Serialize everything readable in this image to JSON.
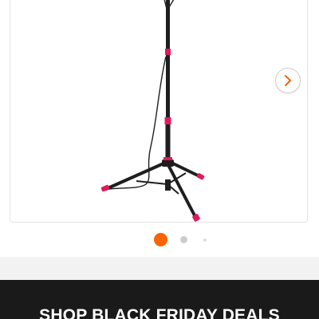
{
  "carousel": {
    "image_alt": "Portable light stand tripod with red accents",
    "next_icon": "chevron-right-icon",
    "slide_count": 3,
    "active_slide": 1
  },
  "promo": {
    "text": "SHOP BLACK FRIDAY DEALS"
  },
  "colors": {
    "accent": "#f96302",
    "dot_inactive": "#cccccc",
    "dot_faint": "#dddddd",
    "banner_bg": "#1a1a1a",
    "stand_pink": "#e0195f",
    "stand_black": "#1e1e1e",
    "chevron": "#f96302"
  }
}
